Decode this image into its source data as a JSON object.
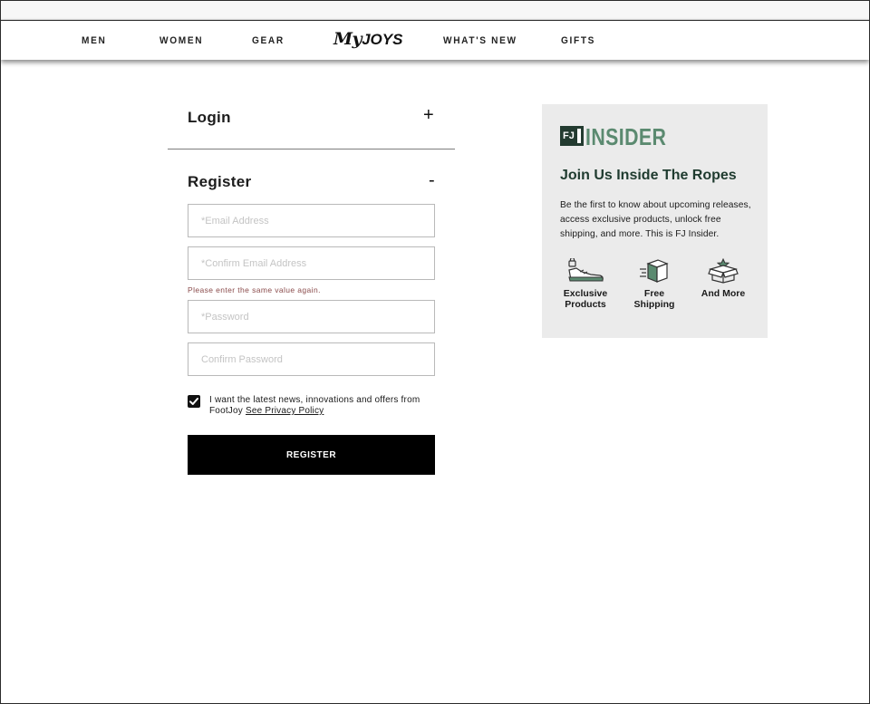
{
  "nav": {
    "items": [
      "MEN",
      "WOMEN",
      "GEAR",
      "WHAT'S NEW",
      "GIFTS"
    ],
    "logo_prefix": "My",
    "logo_suffix": "JOYS"
  },
  "login": {
    "title": "Login",
    "toggle": "+"
  },
  "register": {
    "title": "Register",
    "toggle": "-",
    "fields": {
      "email_placeholder": "*Email Address",
      "confirm_email_placeholder": "*Confirm Email Address",
      "password_placeholder": "*Password",
      "confirm_password_placeholder": "Confirm Password"
    },
    "error": "Please enter the same value again.",
    "consent_text": "I want the latest news, innovations and offers from FootJoy",
    "privacy_link": "See Privacy Policy",
    "consent_checked": true,
    "button_label": "REGISTER"
  },
  "insider": {
    "logo_badge": "FJ",
    "logo_word": "INSIDER",
    "heading": "Join Us Inside The Ropes",
    "body": "Be the first to know about upcoming releases, access exclusive products, unlock free shipping, and more. This is FJ Insider.",
    "perks": [
      {
        "icon": "shoe-icon",
        "line1": "Exclusive",
        "line2": "Products"
      },
      {
        "icon": "box-icon",
        "line1": "Free",
        "line2": "Shipping"
      },
      {
        "icon": "open-box-star-icon",
        "line1": "And More",
        "line2": ""
      }
    ],
    "accent_color": "#5b8a70",
    "dark_color": "#233b30"
  }
}
